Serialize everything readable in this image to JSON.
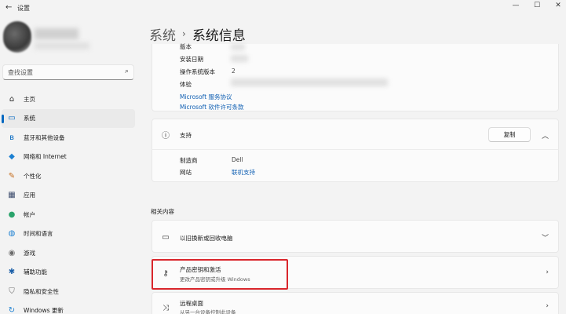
{
  "window": {
    "title": "设置",
    "controls": [
      "—",
      "☐",
      "✕"
    ]
  },
  "search": {
    "placeholder": "查找设置"
  },
  "nav": [
    {
      "label": "主页",
      "icon": "home-icon",
      "glyph": "⌂",
      "color": "#2b2b2b"
    },
    {
      "label": "系统",
      "icon": "system-icon",
      "glyph": "▭",
      "color": "#0067c0",
      "active": true
    },
    {
      "label": "蓝牙和其他设备",
      "icon": "bluetooth-icon",
      "glyph": "ʙ",
      "color": "#0067c0"
    },
    {
      "label": "网络和 Internet",
      "icon": "network-icon",
      "glyph": "◆",
      "color": "#1b7fd1"
    },
    {
      "label": "个性化",
      "icon": "personalization-icon",
      "glyph": "✎",
      "color": "#c46a1a"
    },
    {
      "label": "应用",
      "icon": "apps-icon",
      "glyph": "▦",
      "color": "#3a4a6b"
    },
    {
      "label": "帐户",
      "icon": "accounts-icon",
      "glyph": "●",
      "color": "#2aa36b"
    },
    {
      "label": "时间和语言",
      "icon": "time-language-icon",
      "glyph": "◍",
      "color": "#1b7fd1"
    },
    {
      "label": "游戏",
      "icon": "gaming-icon",
      "glyph": "◉",
      "color": "#6b6b6b"
    },
    {
      "label": "辅助功能",
      "icon": "accessibility-icon",
      "glyph": "✱",
      "color": "#1b5fa8"
    },
    {
      "label": "隐私和安全性",
      "icon": "privacy-icon",
      "glyph": "⛉",
      "color": "#6b6b6b"
    },
    {
      "label": "Windows 更新",
      "icon": "windows-update-icon",
      "glyph": "↻",
      "color": "#1b7fd1"
    }
  ],
  "breadcrumb": {
    "parent": "系统",
    "separator": "›",
    "current": "系统信息"
  },
  "windows_spec": {
    "edition_label": "版本",
    "install_date_label": "安装日期",
    "os_build_label": "操作系统版本",
    "os_build_value": "2",
    "experience_label": "体验",
    "link_service": "Microsoft 服务协议",
    "link_license": "Microsoft 软件许可条款"
  },
  "support": {
    "title": "支持",
    "copy_button": "复制",
    "manufacturer_label": "制造商",
    "manufacturer_value": "Dell",
    "website_label": "网站",
    "website_link": "联机支持"
  },
  "related": {
    "heading": "相关内容",
    "items": [
      {
        "title": "以旧换新或回收电脑",
        "subtitle": ""
      },
      {
        "title": "产品密钥和激活",
        "subtitle": "更改产品密钥或升级 Windows"
      },
      {
        "title": "远程桌面",
        "subtitle": "从另一台设备控制此设备"
      }
    ]
  },
  "colors": {
    "accent": "#0067c0",
    "link": "#0f5fb3",
    "highlight": "#d9262c"
  }
}
